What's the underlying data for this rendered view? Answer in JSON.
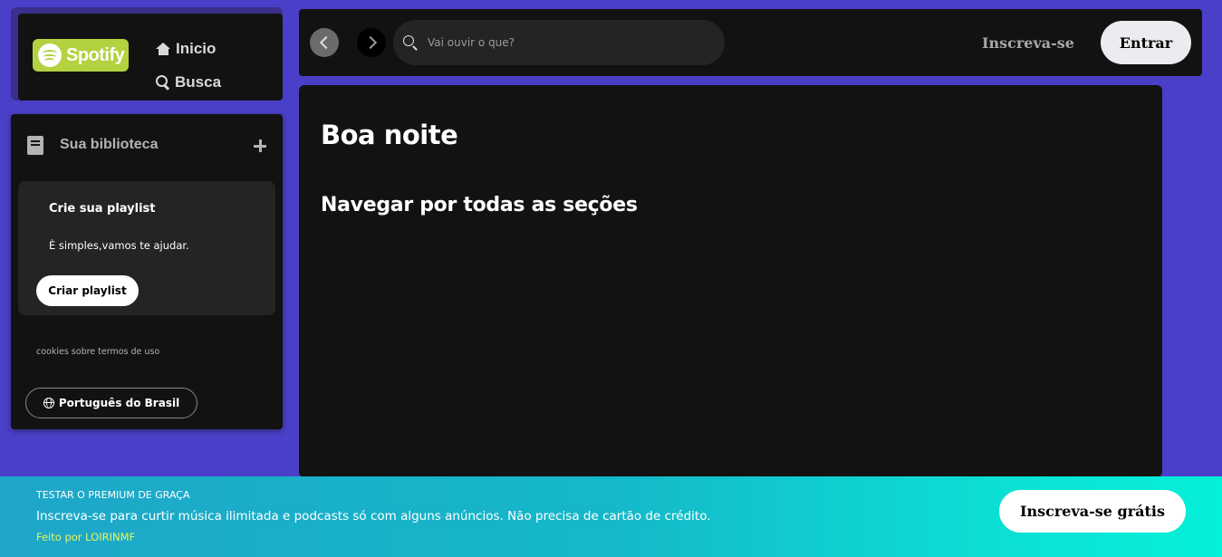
{
  "nav": {
    "logo_text": "Spotify",
    "home_label": "Inicio",
    "search_label": "Busca"
  },
  "library": {
    "title": "Sua biblioteca",
    "playlist_card": {
      "title": "Crie sua playlist",
      "subtitle": "È simples,vamos te ajudar.",
      "button_label": "Criar playlist"
    },
    "footer_links": "cookies sobre termos de uso",
    "language_button": "Português do Brasil"
  },
  "topbar": {
    "search_placeholder": "Vai ouvir o que?",
    "signup_label": "Inscreva-se",
    "login_label": "Entrar"
  },
  "main": {
    "greeting": "Boa noite",
    "section_title": "Navegar por todas as seções"
  },
  "banner": {
    "kicker": "TESTAR O PREMIUM DE GRAÇA",
    "text": "Inscreva-se para curtir música ilimitada e podcasts só com alguns anúncios. Não precisa de cartão de crédito.",
    "credit": "Feito por LOIRINMF",
    "button_label": "Inscreva-se grátis"
  },
  "colors": {
    "background": "#4a3fc8",
    "panel": "#121212",
    "card": "#242424",
    "logo_bg": "#b3d23f",
    "banner_start": "#1ea6c9",
    "banner_end": "#05f0d8",
    "credit": "#e6f55a"
  },
  "icons": [
    "spotify-logo-icon",
    "home-icon",
    "search-icon",
    "library-icon",
    "plus-icon",
    "globe-icon",
    "chevron-left-icon",
    "chevron-right-icon"
  ]
}
